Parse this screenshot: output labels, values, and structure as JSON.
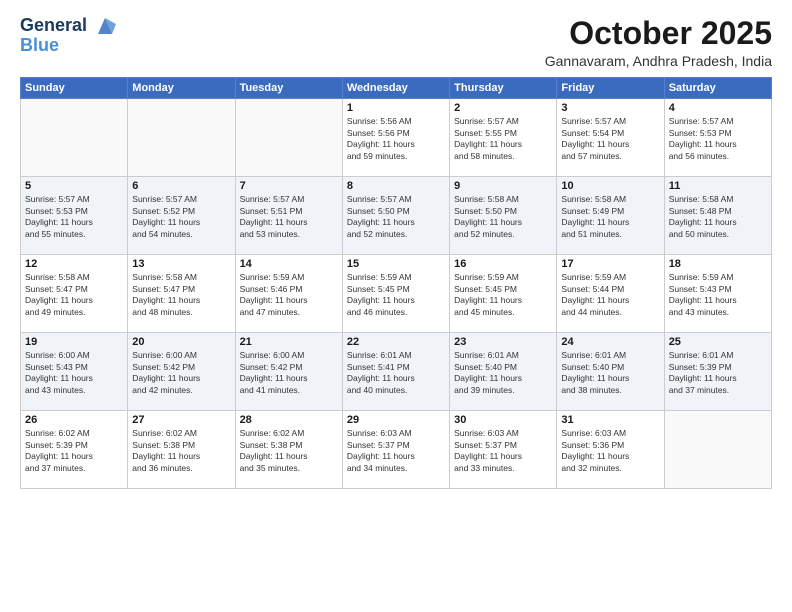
{
  "header": {
    "logo_line1": "General",
    "logo_line2": "Blue",
    "month": "October 2025",
    "location": "Gannavaram, Andhra Pradesh, India"
  },
  "weekdays": [
    "Sunday",
    "Monday",
    "Tuesday",
    "Wednesday",
    "Thursday",
    "Friday",
    "Saturday"
  ],
  "weeks": [
    [
      {
        "day": "",
        "info": ""
      },
      {
        "day": "",
        "info": ""
      },
      {
        "day": "",
        "info": ""
      },
      {
        "day": "1",
        "info": "Sunrise: 5:56 AM\nSunset: 5:56 PM\nDaylight: 11 hours\nand 59 minutes."
      },
      {
        "day": "2",
        "info": "Sunrise: 5:57 AM\nSunset: 5:55 PM\nDaylight: 11 hours\nand 58 minutes."
      },
      {
        "day": "3",
        "info": "Sunrise: 5:57 AM\nSunset: 5:54 PM\nDaylight: 11 hours\nand 57 minutes."
      },
      {
        "day": "4",
        "info": "Sunrise: 5:57 AM\nSunset: 5:53 PM\nDaylight: 11 hours\nand 56 minutes."
      }
    ],
    [
      {
        "day": "5",
        "info": "Sunrise: 5:57 AM\nSunset: 5:53 PM\nDaylight: 11 hours\nand 55 minutes."
      },
      {
        "day": "6",
        "info": "Sunrise: 5:57 AM\nSunset: 5:52 PM\nDaylight: 11 hours\nand 54 minutes."
      },
      {
        "day": "7",
        "info": "Sunrise: 5:57 AM\nSunset: 5:51 PM\nDaylight: 11 hours\nand 53 minutes."
      },
      {
        "day": "8",
        "info": "Sunrise: 5:57 AM\nSunset: 5:50 PM\nDaylight: 11 hours\nand 52 minutes."
      },
      {
        "day": "9",
        "info": "Sunrise: 5:58 AM\nSunset: 5:50 PM\nDaylight: 11 hours\nand 52 minutes."
      },
      {
        "day": "10",
        "info": "Sunrise: 5:58 AM\nSunset: 5:49 PM\nDaylight: 11 hours\nand 51 minutes."
      },
      {
        "day": "11",
        "info": "Sunrise: 5:58 AM\nSunset: 5:48 PM\nDaylight: 11 hours\nand 50 minutes."
      }
    ],
    [
      {
        "day": "12",
        "info": "Sunrise: 5:58 AM\nSunset: 5:47 PM\nDaylight: 11 hours\nand 49 minutes."
      },
      {
        "day": "13",
        "info": "Sunrise: 5:58 AM\nSunset: 5:47 PM\nDaylight: 11 hours\nand 48 minutes."
      },
      {
        "day": "14",
        "info": "Sunrise: 5:59 AM\nSunset: 5:46 PM\nDaylight: 11 hours\nand 47 minutes."
      },
      {
        "day": "15",
        "info": "Sunrise: 5:59 AM\nSunset: 5:45 PM\nDaylight: 11 hours\nand 46 minutes."
      },
      {
        "day": "16",
        "info": "Sunrise: 5:59 AM\nSunset: 5:45 PM\nDaylight: 11 hours\nand 45 minutes."
      },
      {
        "day": "17",
        "info": "Sunrise: 5:59 AM\nSunset: 5:44 PM\nDaylight: 11 hours\nand 44 minutes."
      },
      {
        "day": "18",
        "info": "Sunrise: 5:59 AM\nSunset: 5:43 PM\nDaylight: 11 hours\nand 43 minutes."
      }
    ],
    [
      {
        "day": "19",
        "info": "Sunrise: 6:00 AM\nSunset: 5:43 PM\nDaylight: 11 hours\nand 43 minutes."
      },
      {
        "day": "20",
        "info": "Sunrise: 6:00 AM\nSunset: 5:42 PM\nDaylight: 11 hours\nand 42 minutes."
      },
      {
        "day": "21",
        "info": "Sunrise: 6:00 AM\nSunset: 5:42 PM\nDaylight: 11 hours\nand 41 minutes."
      },
      {
        "day": "22",
        "info": "Sunrise: 6:01 AM\nSunset: 5:41 PM\nDaylight: 11 hours\nand 40 minutes."
      },
      {
        "day": "23",
        "info": "Sunrise: 6:01 AM\nSunset: 5:40 PM\nDaylight: 11 hours\nand 39 minutes."
      },
      {
        "day": "24",
        "info": "Sunrise: 6:01 AM\nSunset: 5:40 PM\nDaylight: 11 hours\nand 38 minutes."
      },
      {
        "day": "25",
        "info": "Sunrise: 6:01 AM\nSunset: 5:39 PM\nDaylight: 11 hours\nand 37 minutes."
      }
    ],
    [
      {
        "day": "26",
        "info": "Sunrise: 6:02 AM\nSunset: 5:39 PM\nDaylight: 11 hours\nand 37 minutes."
      },
      {
        "day": "27",
        "info": "Sunrise: 6:02 AM\nSunset: 5:38 PM\nDaylight: 11 hours\nand 36 minutes."
      },
      {
        "day": "28",
        "info": "Sunrise: 6:02 AM\nSunset: 5:38 PM\nDaylight: 11 hours\nand 35 minutes."
      },
      {
        "day": "29",
        "info": "Sunrise: 6:03 AM\nSunset: 5:37 PM\nDaylight: 11 hours\nand 34 minutes."
      },
      {
        "day": "30",
        "info": "Sunrise: 6:03 AM\nSunset: 5:37 PM\nDaylight: 11 hours\nand 33 minutes."
      },
      {
        "day": "31",
        "info": "Sunrise: 6:03 AM\nSunset: 5:36 PM\nDaylight: 11 hours\nand 32 minutes."
      },
      {
        "day": "",
        "info": ""
      }
    ]
  ]
}
